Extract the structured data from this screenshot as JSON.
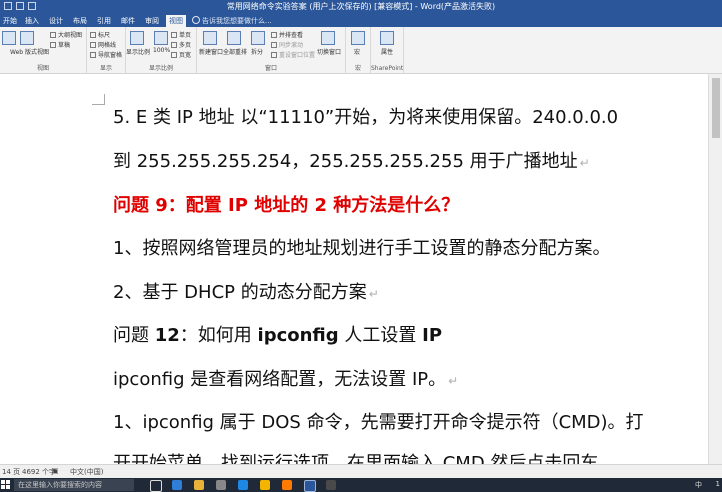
{
  "window": {
    "title": "常用网络命令实验答案 (用户上次保存的) [兼容模式] - Word(产品激活失败)"
  },
  "tabs": [
    "开始",
    "插入",
    "设计",
    "布局",
    "引用",
    "邮件",
    "审阅",
    "视图"
  ],
  "active_tab": "视图",
  "tell_me": "告诉我您想要做什么...",
  "ribbon": {
    "views": {
      "web_layout": "Web 版式视图",
      "outline": "大纲视图",
      "draft": "草稿",
      "label": "视图"
    },
    "show": {
      "ruler": "标尺",
      "gridlines": "网格线",
      "nav_pane": "导航窗格",
      "label": "显示"
    },
    "zoom": {
      "zoom": "显示比例",
      "pct100": "100%",
      "one_page": "单页",
      "multi_page": "多页",
      "page_width": "页宽",
      "label": "显示比例"
    },
    "window": {
      "new_window": "新建窗口",
      "arrange_all": "全部重排",
      "split": "拆分",
      "side_by_side": "并排查看",
      "sync_scroll": "同步滚动",
      "reset_pos": "重设窗口位置",
      "switch_windows": "切换窗口",
      "label": "窗口"
    },
    "macros": {
      "macro": "宏",
      "label": "宏"
    },
    "sharepoint": {
      "properties": "属性",
      "label": "SharePoint"
    }
  },
  "document": {
    "lines": [
      {
        "text": "5.    E 类 IP 地址  以“11110”开始，为将来使用保留。240.0.0.0"
      },
      {
        "text": "到 255.255.255.254，255.255.255.255 用于广播地址"
      },
      {
        "text": "问题 9：配置 IP 地址的 2 种方法是什么？"
      },
      {
        "text": "1、按照网络管理员的地址规划进行手工设置的静态分配方案。"
      },
      {
        "text": "2、基于 DHCP 的动态分配方案"
      },
      {
        "pre": "问题 ",
        "bold1": "12",
        "mid": "：如何用 ",
        "bold2": "ipconfig",
        "mid2": " 人工设置 ",
        "bold3": "IP"
      },
      {
        "text": "ipconfig 是查看网络配置，无法设置 IP。"
      },
      {
        "text": "1、ipconfig 属于 DOS 命令，先需要打开命令提示符（CMD)。打"
      },
      {
        "text": "开开始菜单，找到运行选项，在里面输入 CMD 然后点击回车"
      }
    ]
  },
  "status": {
    "page": "14 页",
    "words": "4692 个字",
    "lang": "中文(中国)"
  },
  "taskbar": {
    "search": "在这里输入你要搜索的内容",
    "ime": "中",
    "clock": "1"
  }
}
